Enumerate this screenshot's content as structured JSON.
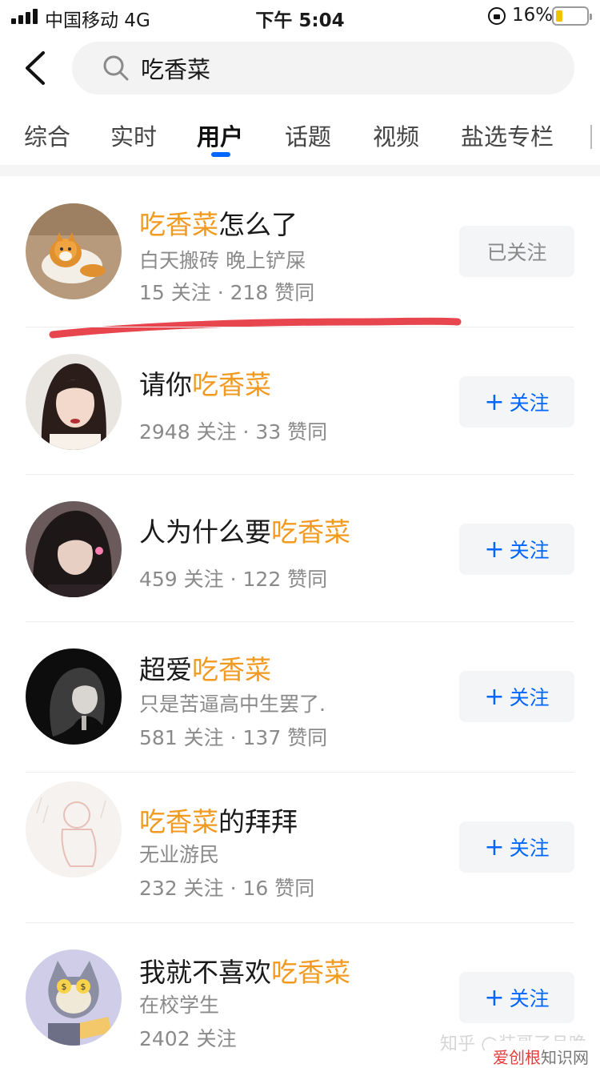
{
  "status_bar": {
    "carrier": "中国移动  4G",
    "time": "下午 5:04",
    "battery": "16%"
  },
  "search": {
    "query": "吃香菜"
  },
  "tabs": [
    {
      "label": "综合"
    },
    {
      "label": "实时"
    },
    {
      "label": "用户",
      "active": true
    },
    {
      "label": "话题"
    },
    {
      "label": "视频"
    },
    {
      "label": "盐选专栏"
    }
  ],
  "colors": {
    "highlight": "#f29a1f",
    "accent": "#0066ff",
    "red_mark": "#e8464f"
  },
  "users": [
    {
      "name_pre": "",
      "name_hl": "吃香菜",
      "name_post": "怎么了",
      "bio": "白天搬砖 晚上铲屎",
      "stats": "15 关注 · 218 赞同",
      "follow_label": "已关注",
      "followed": true
    },
    {
      "name_pre": "请你",
      "name_hl": "吃香菜",
      "name_post": "",
      "bio": "",
      "stats": "2948 关注 · 33 赞同",
      "follow_label": "关注",
      "followed": false
    },
    {
      "name_pre": "人为什么要",
      "name_hl": "吃香菜",
      "name_post": "",
      "bio": "",
      "stats": "459 关注 · 122 赞同",
      "follow_label": "关注",
      "followed": false
    },
    {
      "name_pre": "超爱",
      "name_hl": "吃香菜",
      "name_post": "",
      "bio": "只是苦逼高中生罢了.",
      "stats": "581 关注 · 137 赞同",
      "follow_label": "关注",
      "followed": false
    },
    {
      "name_pre": "",
      "name_hl": "吃香菜",
      "name_post": "的拜拜",
      "bio": "无业游民",
      "stats": "232 关注 · 16 赞同",
      "follow_label": "关注",
      "followed": false
    },
    {
      "name_pre": "我就不喜欢",
      "name_hl": "吃香菜",
      "name_post": "",
      "bio": "在校学生",
      "stats": "2402 关注",
      "follow_label": "关注",
      "followed": false
    }
  ],
  "follow_plus": "+",
  "watermark": "知乎 @装哥了且晚",
  "site_a": "爱创根",
  "site_b": "知识网"
}
